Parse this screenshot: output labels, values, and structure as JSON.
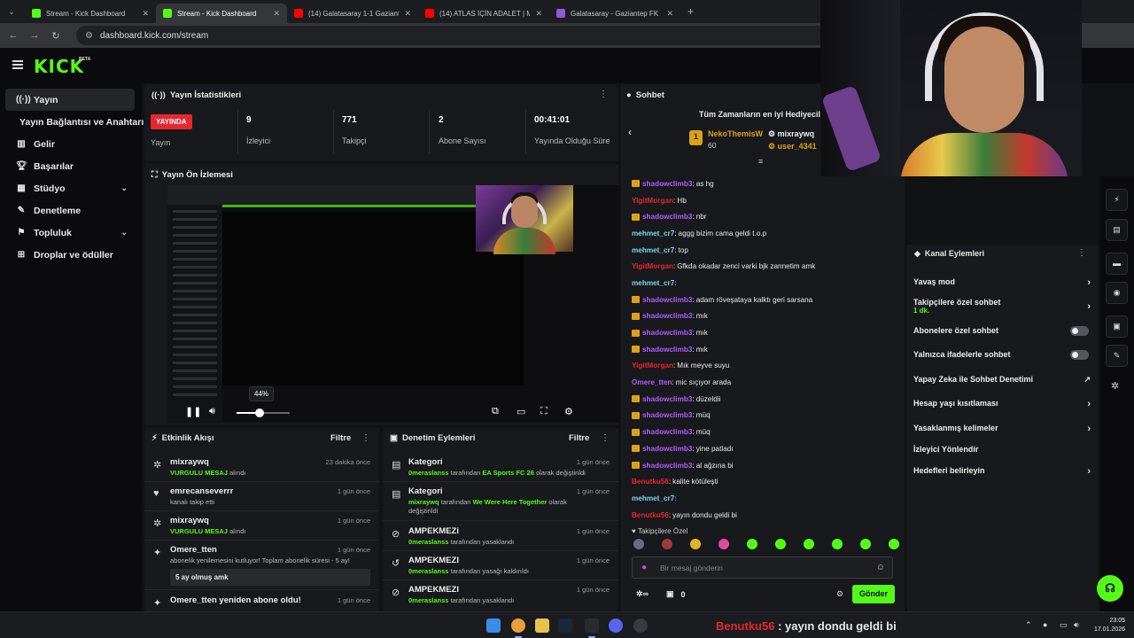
{
  "browser": {
    "tabs": [
      {
        "label": "Stream - Kick Dashboard",
        "icon": "kick-icon",
        "active": false
      },
      {
        "label": "Stream - Kick Dashboard",
        "icon": "kick-icon",
        "active": true
      },
      {
        "label": "(14) Galatasaray 1-1 Gaziantep",
        "icon": "youtube-icon",
        "active": false
      },
      {
        "label": "(14) ATLAS İÇİN ADALET | Mad",
        "icon": "youtube-icon",
        "active": false
      },
      {
        "label": "Galatasaray - Gaziantep FK Ma",
        "icon": "page-icon",
        "active": false
      }
    ],
    "url": "dashboard.kick.com/stream"
  },
  "header": {
    "logo": "KICK",
    "logo_tag": "BETA"
  },
  "sidebar": {
    "items": [
      {
        "label": "Yayın",
        "icon": "broadcast-icon"
      },
      {
        "label": "Yayın Bağlantısı ve Anahtarı",
        "icon": ""
      },
      {
        "label": "Gelir",
        "icon": "chart-icon"
      },
      {
        "label": "Başarılar",
        "icon": "trophy-icon"
      },
      {
        "label": "Stüdyo",
        "icon": "studio-icon"
      },
      {
        "label": "Denetleme",
        "icon": "wrench-icon"
      },
      {
        "label": "Topluluk",
        "icon": "community-icon"
      },
      {
        "label": "Droplar ve ödüller",
        "icon": "gift-icon"
      }
    ]
  },
  "stats": {
    "title": "Yayın İstatistikleri",
    "live_badge": "YAYINDA",
    "columns": [
      {
        "value": "",
        "label": "Yayın"
      },
      {
        "value": "9",
        "label": "İzleyici"
      },
      {
        "value": "771",
        "label": "Takipçi"
      },
      {
        "value": "2",
        "label": "Abone Sayısı"
      },
      {
        "value": "00:41:01",
        "label": "Yayında Olduğu Süre"
      }
    ]
  },
  "preview": {
    "title": "Yayın Ön İzlemesi",
    "volume_label": "44%",
    "volume": 0.44
  },
  "activity": {
    "title": "Etkinlik Akışı",
    "filter": "Filtre",
    "items": [
      {
        "name": "mixraywq",
        "highlight": "VURGULU MESAJ",
        "desc": " alındı",
        "time": "23 dakika önce"
      },
      {
        "name": "emrecanseverrr",
        "highlight": "",
        "desc": "kanalı takip etti",
        "time": "1 gün önce"
      },
      {
        "name": "mixraywq",
        "highlight": "VURGULU MESAJ",
        "desc": " alındı",
        "time": "1 gün önce"
      },
      {
        "name": "Omere_tten",
        "highlight": "",
        "desc": "abonelik yenilemesini kutluyor! Toplam abonelik süresi - 5 ay!",
        "time": "1 gün önce"
      },
      {
        "name": "Omere_tten yeniden abone oldu!",
        "highlight": "",
        "desc": "",
        "time": "1 gün önce"
      }
    ],
    "sub_message": "5 ay olmuş amk"
  },
  "moderation": {
    "title": "Denetim Eylemleri",
    "filter": "Filtre",
    "items": [
      {
        "title": "Kategori",
        "actor": "0meraslanss",
        "mid": " tarafından ",
        "target": "EA Sports FC 26",
        "tail": " olarak değiştirildi",
        "time": "1 gün önce"
      },
      {
        "title": "Kategori",
        "actor": "mixraywq",
        "mid": " tarafından ",
        "target": "We Were Here Together",
        "tail": " olarak değiştirildi",
        "time": "1 gün önce"
      },
      {
        "title": "AMPEKMEZi",
        "actor": "0meraslanss",
        "mid": " tarafından yasaklandı",
        "target": "",
        "tail": "",
        "time": "1 gün önce"
      },
      {
        "title": "AMPEKMEZI",
        "actor": "0meraslanss",
        "mid": " tarafından yasağı kaldırıldı",
        "target": "",
        "tail": "",
        "time": "1 gün önce"
      },
      {
        "title": "AMPEKMEZI",
        "actor": "0meraslanss",
        "mid": " tarafından yasaklandı",
        "target": "",
        "tail": "",
        "time": "1 gün önce"
      }
    ]
  },
  "chat": {
    "title": "Sohbet",
    "gifters_title": "Tüm Zamanların en iyi Hediyeciler",
    "gifters": [
      {
        "rank": "1",
        "name": "NekoThemisW",
        "count": "60"
      },
      {
        "rank": "",
        "name": "mixraywq",
        "count": ""
      },
      {
        "rank": "",
        "name": "user_4341",
        "count": ""
      }
    ],
    "messages": [
      {
        "user": "shadowclimb3",
        "color": "#b05cff",
        "badge": true,
        "msg": "as hg"
      },
      {
        "user": "YigitMorgan",
        "color": "#e5272f",
        "badge": false,
        "msg": "Hb"
      },
      {
        "user": "shadowclimb3",
        "color": "#b05cff",
        "badge": true,
        "msg": "nbr"
      },
      {
        "user": "mehmet_cr7",
        "color": "#7fd4e8",
        "badge": false,
        "msg": "aggg bizim cama geldi t.o.p"
      },
      {
        "user": "mehmet_cr7",
        "color": "#7fd4e8",
        "badge": false,
        "msg": "top"
      },
      {
        "user": "YigitMorgan",
        "color": "#e5272f",
        "badge": false,
        "msg": "Gfkda okadar zenci varki bjk zannetim amk"
      },
      {
        "user": "mehmet_cr7",
        "color": "#7fd4e8",
        "badge": false,
        "msg": ""
      },
      {
        "user": "shadowclimb3",
        "color": "#b05cff",
        "badge": true,
        "msg": "adam röveşataya kalktı geri sarsana"
      },
      {
        "user": "shadowclimb3",
        "color": "#b05cff",
        "badge": true,
        "msg": "mık"
      },
      {
        "user": "shadowclimb3",
        "color": "#b05cff",
        "badge": true,
        "msg": "mık"
      },
      {
        "user": "shadowclimb3",
        "color": "#b05cff",
        "badge": true,
        "msg": "mık"
      },
      {
        "user": "YigitMorgan",
        "color": "#e5272f",
        "badge": false,
        "msg": "Mık meyve suyu"
      },
      {
        "user": "Omere_tten",
        "color": "#b05cff",
        "badge": false,
        "msg": "mic sıçıyor arada"
      },
      {
        "user": "shadowclimb3",
        "color": "#b05cff",
        "badge": true,
        "msg": "düzeldii"
      },
      {
        "user": "shadowclimb3",
        "color": "#b05cff",
        "badge": true,
        "msg": "müq"
      },
      {
        "user": "shadowclimb3",
        "color": "#b05cff",
        "badge": true,
        "msg": "müq"
      },
      {
        "user": "shadowclimb3",
        "color": "#b05cff",
        "badge": true,
        "msg": "yine patladı"
      },
      {
        "user": "shadowclimb3",
        "color": "#b05cff",
        "badge": true,
        "msg": "al ağzına bi"
      },
      {
        "user": "Benutku56",
        "color": "#e5272f",
        "badge": false,
        "msg": "kalite kötüleşti"
      },
      {
        "user": "mehmet_cr7",
        "color": "#7fd4e8",
        "badge": false,
        "msg": ""
      },
      {
        "user": "Benutku56",
        "color": "#e5272f",
        "badge": false,
        "msg": "yayın dondu geldi bi"
      }
    ],
    "followers_note": "Takipçilere Özel",
    "placeholder": "Bir mesaj gönderin",
    "points": "0",
    "send": "Gönder"
  },
  "channel_actions": {
    "title": "Kanal Eylemleri",
    "items": [
      {
        "label": "Yavaş mod",
        "sub": "",
        "control": "arrow"
      },
      {
        "label": "Takipçilere özel sohbet",
        "sub": "1 dk.",
        "control": "arrow"
      },
      {
        "label": "Abonelere özel sohbet",
        "sub": "",
        "control": "toggle"
      },
      {
        "label": "Yalnızca ifadelerle sohbet",
        "sub": "",
        "control": "toggle"
      },
      {
        "label": "Yapay Zeka ile Sohbet Denetimi",
        "sub": "",
        "control": "external"
      },
      {
        "label": "Hesap yaşı kısıtlaması",
        "sub": "",
        "control": "arrow"
      },
      {
        "label": "Yasaklanmış kelimeler",
        "sub": "",
        "control": "arrow"
      },
      {
        "label": "İzleyici Yönlendir",
        "sub": "",
        "control": "none"
      },
      {
        "label": "Hedefleri belirleyin",
        "sub": "",
        "control": "arrow"
      }
    ]
  },
  "taskbar": {
    "caption_user": "Benutku56",
    "caption_msg": " : yayın dondu geldi bi",
    "time": "23:05",
    "date": "17.01.2026"
  },
  "colors": {
    "accent": "#53fc18",
    "live": "#e5272f",
    "panel": "#18191c",
    "bg": "#0b0b0d"
  }
}
